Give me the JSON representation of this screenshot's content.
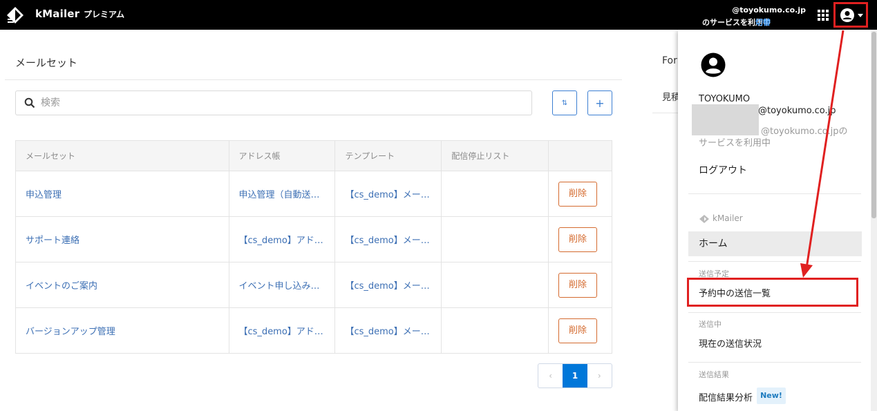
{
  "header": {
    "brand": "kMailer",
    "plan": "プレミアム",
    "account_email": "@toyokumo.co.jp",
    "account_service": "のサービスを利用中",
    "switch_label": "切替"
  },
  "main": {
    "title": "メールセット",
    "search_placeholder": "検索",
    "sort_label": "⇅",
    "add_label": "+",
    "columns": [
      "メールセット",
      "アドレス帳",
      "テンプレート",
      "配信停止リスト",
      ""
    ],
    "rows": [
      {
        "name": "申込管理",
        "address_book": "申込管理（自動送…",
        "template": "【cs_demo】メー…",
        "unsubscribe": "",
        "delete": "削除"
      },
      {
        "name": "サポート連絡",
        "address_book": "【cs_demo】アド…",
        "template": "【cs_demo】メー…",
        "unsubscribe": "",
        "delete": "削除"
      },
      {
        "name": "イベントのご案内",
        "address_book": "イベント申し込み…",
        "template": "【cs_demo】メー…",
        "unsubscribe": "",
        "delete": "削除"
      },
      {
        "name": "バージョンアップ管理",
        "address_book": "【cs_demo】アド…",
        "template": "【cs_demo】メー…",
        "unsubscribe": "",
        "delete": "削除"
      }
    ],
    "pagination": {
      "prev": "‹",
      "current": "1",
      "next": "›"
    }
  },
  "right_panel": {
    "title": "Forı",
    "item": "見積"
  },
  "dropdown": {
    "company": "TOYOKUMO",
    "email": "@toyokumo.co.jp",
    "service_line1": "@toyokumo.co.jpの",
    "service_line2": "サービスを利用中",
    "logout": "ログアウト",
    "app_name": "kMailer",
    "home": "ホーム",
    "section_scheduled": "送信予定",
    "scheduled_list": "予約中の送信一覧",
    "section_sending": "送信中",
    "sending_status": "現在の送信状況",
    "section_results": "送信結果",
    "results_analysis": "配信結果分析",
    "new_badge": "New!"
  },
  "colors": {
    "accent": "#3c7fd2",
    "delete": "#d46a2e",
    "highlight": "#e02020",
    "active_page": "#0077d9"
  }
}
